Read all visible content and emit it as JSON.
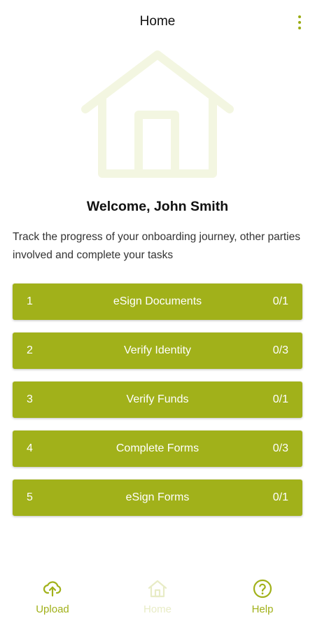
{
  "header": {
    "title": "Home",
    "menu_icon": "more-vertical-icon"
  },
  "hero": {
    "icon": "house-icon"
  },
  "welcome": {
    "text": "Welcome, John Smith"
  },
  "intro": {
    "text": "Track the progress of your onboarding journey, other parties involved and complete your tasks"
  },
  "tasks": [
    {
      "number": "1",
      "label": "eSign Documents",
      "progress": "0/1"
    },
    {
      "number": "2",
      "label": "Verify Identity",
      "progress": "0/3"
    },
    {
      "number": "3",
      "label": "Verify Funds",
      "progress": "0/1"
    },
    {
      "number": "4",
      "label": "Complete Forms",
      "progress": "0/3"
    },
    {
      "number": "5",
      "label": "eSign Forms",
      "progress": "0/1"
    }
  ],
  "bottom_nav": {
    "items": [
      {
        "label": "Upload",
        "icon": "cloud-upload-icon",
        "active": false
      },
      {
        "label": "Home",
        "icon": "home-icon",
        "active": true
      },
      {
        "label": "Help",
        "icon": "help-circle-icon",
        "active": false
      }
    ]
  },
  "colors": {
    "accent": "#a1b11a",
    "hero_tint": "#f3f6e1",
    "inactive_tab": "#e8ecc6",
    "text_primary": "#111111"
  }
}
